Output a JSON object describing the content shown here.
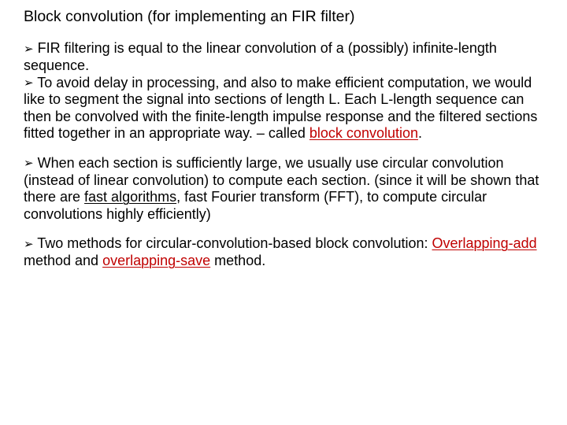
{
  "title": "Block convolution (for implementing an FIR filter)",
  "bullets": {
    "b1": "FIR filtering is equal to the linear convolution of a (possibly) infinite-length sequence.",
    "b2a": "To avoid delay in processing, and also to make efficient computation, we would like to segment the signal into sections of length L. Each L-length sequence can then be convolved with the finite-length impulse response and the filtered sections fitted together in an appropriate way. – called ",
    "b2b_key": "block convolution",
    "b2c": ".",
    "b3a": "When each section is sufficiently large, we usually use circular convolution (instead of linear convolution) to compute each section. (since it will be shown that there are ",
    "b3b_under": "fast algorithms",
    "b3c": ", fast Fourier transform (FFT), to compute circular convolutions highly efficiently)",
    "b4a": "Two methods for circular-convolution-based block convolution: ",
    "b4b_key": "Overlapping-add",
    "b4c": " method and ",
    "b4d_key": "overlapping-save",
    "b4e": " method."
  },
  "arrow": "➢"
}
